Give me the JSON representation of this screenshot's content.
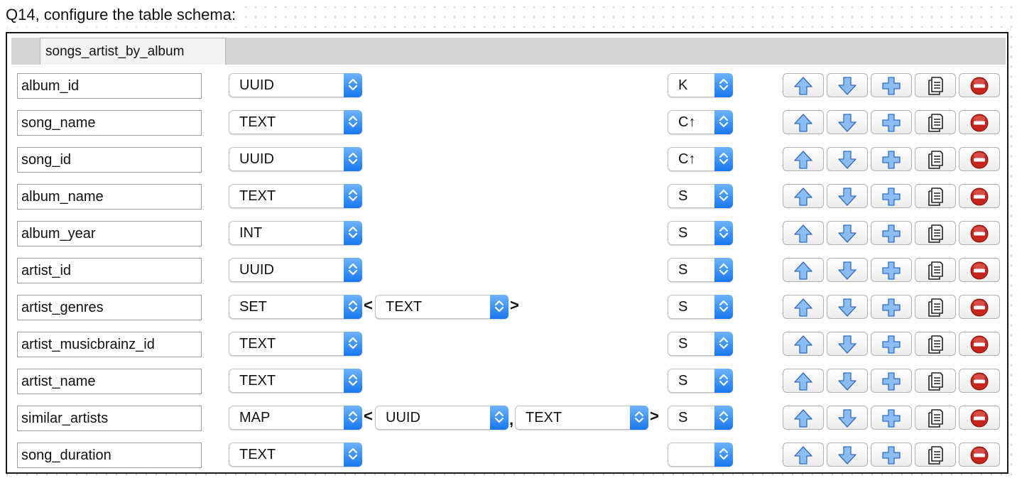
{
  "question": "Q14, configure the table schema:",
  "table_name": "songs_artist_by_album",
  "rows": [
    {
      "name": "album_id",
      "type": "UUID",
      "kind": "K"
    },
    {
      "name": "song_name",
      "type": "TEXT",
      "kind": "C↑"
    },
    {
      "name": "song_id",
      "type": "UUID",
      "kind": "C↑"
    },
    {
      "name": "album_name",
      "type": "TEXT",
      "kind": "S"
    },
    {
      "name": "album_year",
      "type": "INT",
      "kind": "S"
    },
    {
      "name": "artist_id",
      "type": "UUID",
      "kind": "S"
    },
    {
      "name": "artist_genres",
      "type": "SET",
      "subtypes": [
        "TEXT"
      ],
      "kind": "S"
    },
    {
      "name": "artist_musicbrainz_id",
      "type": "TEXT",
      "kind": "S"
    },
    {
      "name": "artist_name",
      "type": "TEXT",
      "kind": "S"
    },
    {
      "name": "similar_artists",
      "type": "MAP",
      "subtypes": [
        "UUID",
        "TEXT"
      ],
      "kind": "S"
    },
    {
      "name": "song_duration",
      "type": "TEXT",
      "kind": ""
    }
  ],
  "punctuation": {
    "open": "<",
    "sep": ",",
    "close": ">"
  },
  "actions": [
    "move-up",
    "move-down",
    "add",
    "copy",
    "delete"
  ],
  "colors": {
    "accent": "#1a78ee",
    "icon_blue": "#8bbcf2",
    "delete_red": "#c6241d"
  }
}
